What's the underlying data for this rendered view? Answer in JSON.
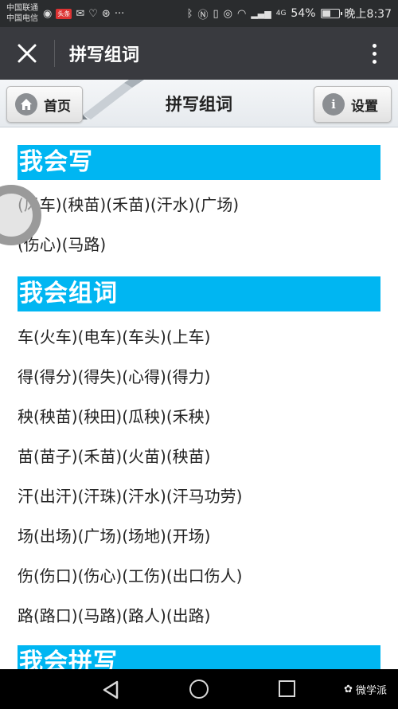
{
  "status_bar": {
    "carrier_1": "中国联通",
    "carrier_2": "中国电信",
    "badge": "头条",
    "battery_percent": "54%",
    "battery_level": 0.54,
    "time": "晚上8:37",
    "network": "4G"
  },
  "app_bar": {
    "title": "拼写组词"
  },
  "page_header": {
    "home_label": "首页",
    "title": "拼写组词",
    "settings_label": "设置",
    "settings_icon_glyph": "i"
  },
  "sections": {
    "s1": {
      "heading": "我会写",
      "lines": [
        "(风车)(秧苗)(禾苗)(汗水)(广场)",
        "(伤心)(马路)"
      ]
    },
    "s2": {
      "heading": "我会组词",
      "lines": [
        "车(火车)(电车)(车头)(上车)",
        "得(得分)(得失)(心得)(得力)",
        "秧(秧苗)(秧田)(瓜秧)(禾秧)",
        "苗(苗子)(禾苗)(火苗)(秧苗)",
        "汗(出汗)(汗珠)(汗水)(汗马功劳)",
        "场(出场)(广场)(场地)(开场)",
        "伤(伤口)(伤心)(工伤)(出口伤人)",
        "路(路口)(马路)(路人)(出路)"
      ]
    },
    "s3": {
      "heading": "我会拼写"
    }
  },
  "watermark": "微学派"
}
